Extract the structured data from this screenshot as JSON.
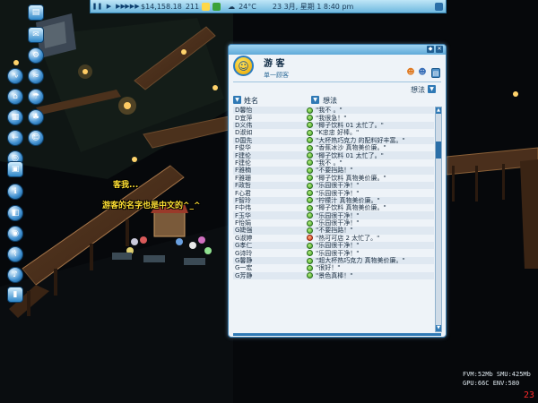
{
  "topbar": {
    "money": "$14,158.18",
    "guests": "211",
    "temperature": "24°C",
    "date_time": "23 3月, 星期 1 8:40 pm"
  },
  "left_toolbar": {
    "icons": [
      "chart-icon",
      "mail-icon",
      "gear-icon",
      "coaster-icon",
      "water-icon",
      "shop-icon",
      "stall-icon",
      "path-icon",
      "tree-icon",
      "staff-icon",
      "scenery-icon",
      "ride-icon",
      "build-icon",
      "info-icon",
      "gallery-icon",
      "microphone-icon",
      "cup-icon"
    ]
  },
  "speech": {
    "line1": "客我...",
    "line2": "游客的名字也是中文的^_^"
  },
  "window": {
    "title": "游 客",
    "subtitle": "单一顾客",
    "sort_label": "想法",
    "columns": {
      "name": "姓名",
      "thought": "想法"
    },
    "rows": [
      {
        "name": "D馨怡",
        "thought": "\"我不 。\""
      },
      {
        "name": "D宜萍",
        "thought": "\"我很急！\""
      },
      {
        "name": "D义伟",
        "thought": "\"椰子饮料 01 太忙了。\""
      },
      {
        "name": "D淑如",
        "thought": "\"K忠忠 好棒。\""
      },
      {
        "name": "D国先",
        "thought": "\"大杯热巧克力 的配料好丰富。\""
      },
      {
        "name": "F俊华",
        "thought": "\"香蕉冰沙 真物美价廉。\""
      },
      {
        "name": "F建伦",
        "thought": "\"椰子饮料 01 太忙了。\""
      },
      {
        "name": "F建伦",
        "thought": "\"我不 。\""
      },
      {
        "name": "F雅楠",
        "thought": "\"不要挡路！\""
      },
      {
        "name": "F雅珊",
        "thought": "\"椰子饮料 真物美价廉。\""
      },
      {
        "name": "F政哲",
        "thought": "\"乐园很干净！\""
      },
      {
        "name": "F心君",
        "thought": "\"乐园很干净！\""
      },
      {
        "name": "F智玲",
        "thought": "\"柠檬汁 真物美价廉。\""
      },
      {
        "name": "F中伟",
        "thought": "\"椰子饮料 真物美价廉。\""
      },
      {
        "name": "F玉华",
        "thought": "\"乐园很干净！\""
      },
      {
        "name": "F怡娟",
        "thought": "\"乐园很干净！\""
      },
      {
        "name": "G婕强",
        "thought": "\"不要挡路！\""
      },
      {
        "name": "G淑婷",
        "thought": "\"热可可店 2 太忙了。\"",
        "mood": "red"
      },
      {
        "name": "G孝仁",
        "thought": "\"乐园很干净！\""
      },
      {
        "name": "G诗玲",
        "thought": "\"乐园很干净！\""
      },
      {
        "name": "G馨静",
        "thought": "\"超大杯热巧克力 真物美价廉。\""
      },
      {
        "name": "G一宏",
        "thought": "\"很好！\""
      },
      {
        "name": "G芳静",
        "thought": "\"景色真棒！\""
      }
    ]
  },
  "debug": {
    "line1": "FVM:52Mb  SMU:425Mb",
    "line2": "GPU:66C ENV:580",
    "fps": "23"
  },
  "colors": {
    "window_bg": "#eef3f8",
    "accent": "#2f79b5",
    "topbar": "#6fb8df"
  }
}
